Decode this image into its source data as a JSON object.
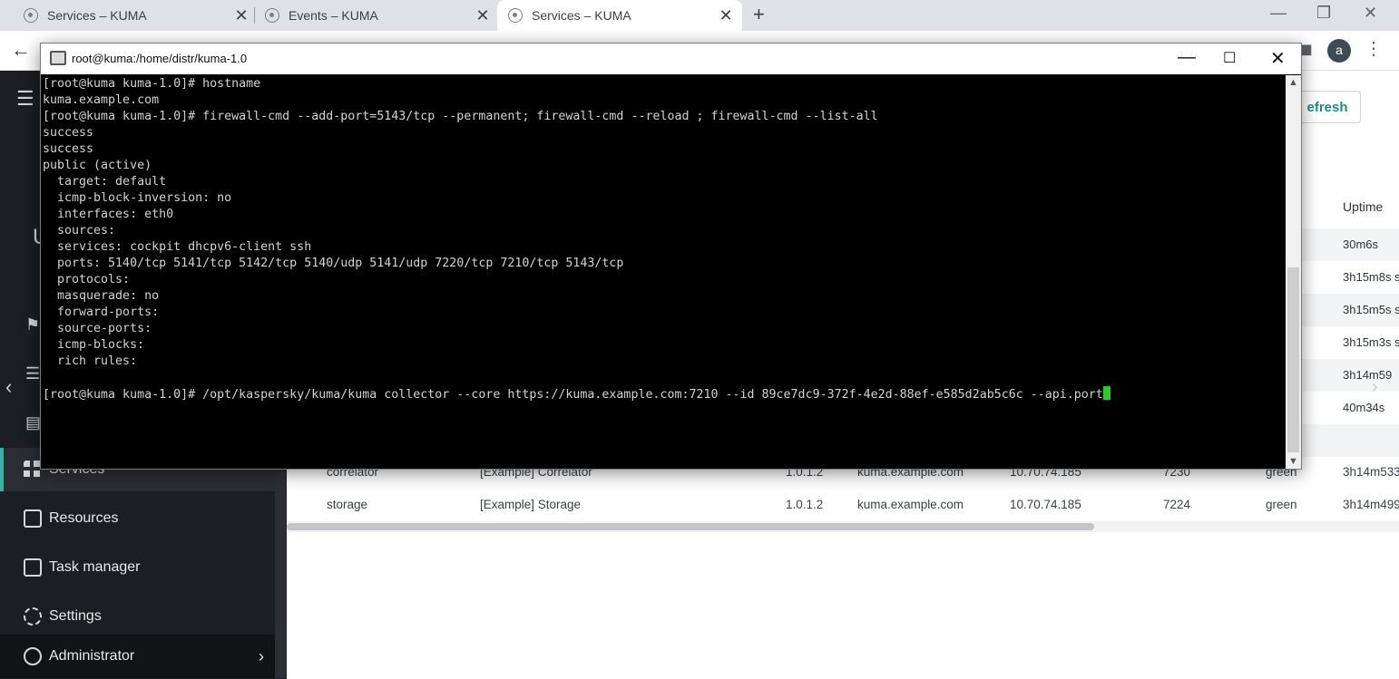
{
  "browser": {
    "tabs": [
      {
        "title": "Services – KUMA",
        "active": false
      },
      {
        "title": "Events – KUMA",
        "active": false
      },
      {
        "title": "Services – KUMA",
        "active": true
      }
    ],
    "new_tab_glyph": "+",
    "close_glyph": "✕",
    "avatar_initial": "a"
  },
  "sidebar": {
    "nav": [
      {
        "label": "Services",
        "icon": "grid-icon",
        "active": true
      },
      {
        "label": "Resources",
        "icon": "sliders-icon",
        "active": false
      },
      {
        "label": "Task manager",
        "icon": "clipboard-icon",
        "active": false
      },
      {
        "label": "Settings",
        "icon": "gear-icon",
        "active": false
      },
      {
        "label": "Administrator",
        "icon": "user-icon",
        "active": false
      }
    ]
  },
  "main": {
    "refresh_label": "efresh",
    "columns": {
      "uptime": "Uptime"
    },
    "uptimes": [
      "30m6s",
      "3h15m8s s",
      "3h15m5s s",
      "3h15m3s s",
      "3h14m59",
      "40m34s"
    ],
    "rows": [
      {
        "type": "correlator",
        "name": "[Example] Correlator",
        "version": "1.0.1.2",
        "fqdn": "kuma.example.com",
        "ip": "10.70.74.185",
        "port": "7230",
        "status": "green",
        "uptime": "3h14m533"
      },
      {
        "type": "storage",
        "name": "[Example] Storage",
        "version": "1.0.1.2",
        "fqdn": "kuma.example.com",
        "ip": "10.70.74.185",
        "port": "7224",
        "status": "green",
        "uptime": "3h14m499"
      }
    ]
  },
  "terminal": {
    "title": "root@kuma:/home/distr/kuma-1.0",
    "lines": [
      "[root@kuma kuma-1.0]# hostname",
      "kuma.example.com",
      "[root@kuma kuma-1.0]# firewall-cmd --add-port=5143/tcp --permanent; firewall-cmd --reload ; firewall-cmd --list-all",
      "success",
      "success",
      "public (active)",
      "  target: default",
      "  icmp-block-inversion: no",
      "  interfaces: eth0",
      "  sources:",
      "  services: cockpit dhcpv6-client ssh",
      "  ports: 5140/tcp 5141/tcp 5142/tcp 5140/udp 5141/udp 7220/tcp 7210/tcp 5143/tcp",
      "  protocols:",
      "  masquerade: no",
      "  forward-ports:",
      "  source-ports:",
      "  icmp-blocks:",
      "  rich rules:",
      "",
      "[root@kuma kuma-1.0]# /opt/kaspersky/kuma/kuma collector --core https://kuma.example.com:7210 --id 89ce7dc9-372f-4e2d-88ef-e585d2ab5c6c --api.port"
    ],
    "cursor_color": "#1fd21f"
  },
  "colors": {
    "accent": "#2eb8a4",
    "sidebar_bg": "#1b1e22",
    "terminal_bg": "#000000",
    "terminal_text": "#d2d2d2"
  }
}
